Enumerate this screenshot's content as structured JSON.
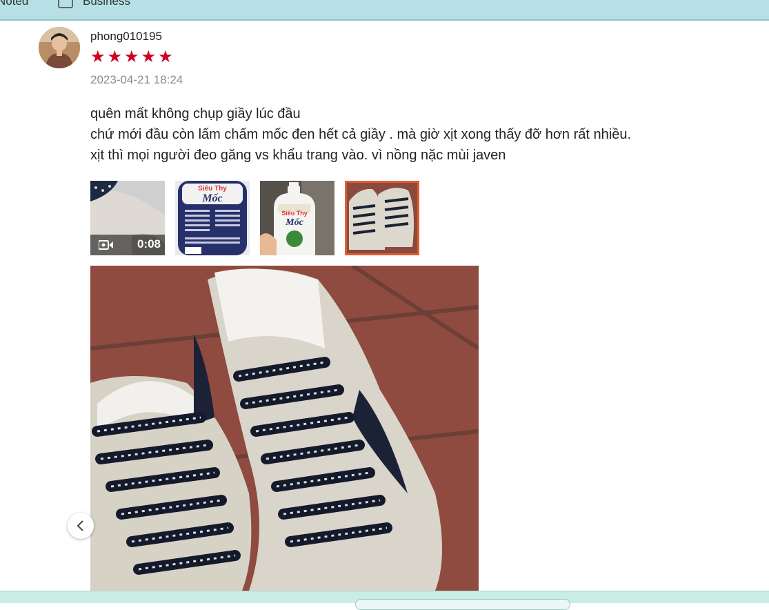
{
  "topbar": {
    "item1": "Noted",
    "item2": "Business"
  },
  "review": {
    "username": "phong010195",
    "rating": 5,
    "stars": [
      "★",
      "★",
      "★",
      "★",
      "★"
    ],
    "date": "2023-04-21 18:24",
    "comment_lines": [
      "quên mất không chụp giầy lúc đầu",
      "chứ mới đầu còn lấm chấm mốc đen hết cả giầy . mà giờ xịt xong thấy đỡ hơn rất nhiều.",
      "xịt thì mọi người đeo găng vs khẩu trang vào. vì nồng nặc mùi javen"
    ],
    "video_duration": "0:08",
    "product_label_top": "Siêu Thy",
    "product_label_main": "Mốc"
  },
  "icons": {
    "video": "video-camera-icon",
    "prev": "chevron-left-icon"
  },
  "colors": {
    "star": "#d0011b",
    "selected_border": "#e05b2f",
    "topbar": "#b6e0e6"
  }
}
